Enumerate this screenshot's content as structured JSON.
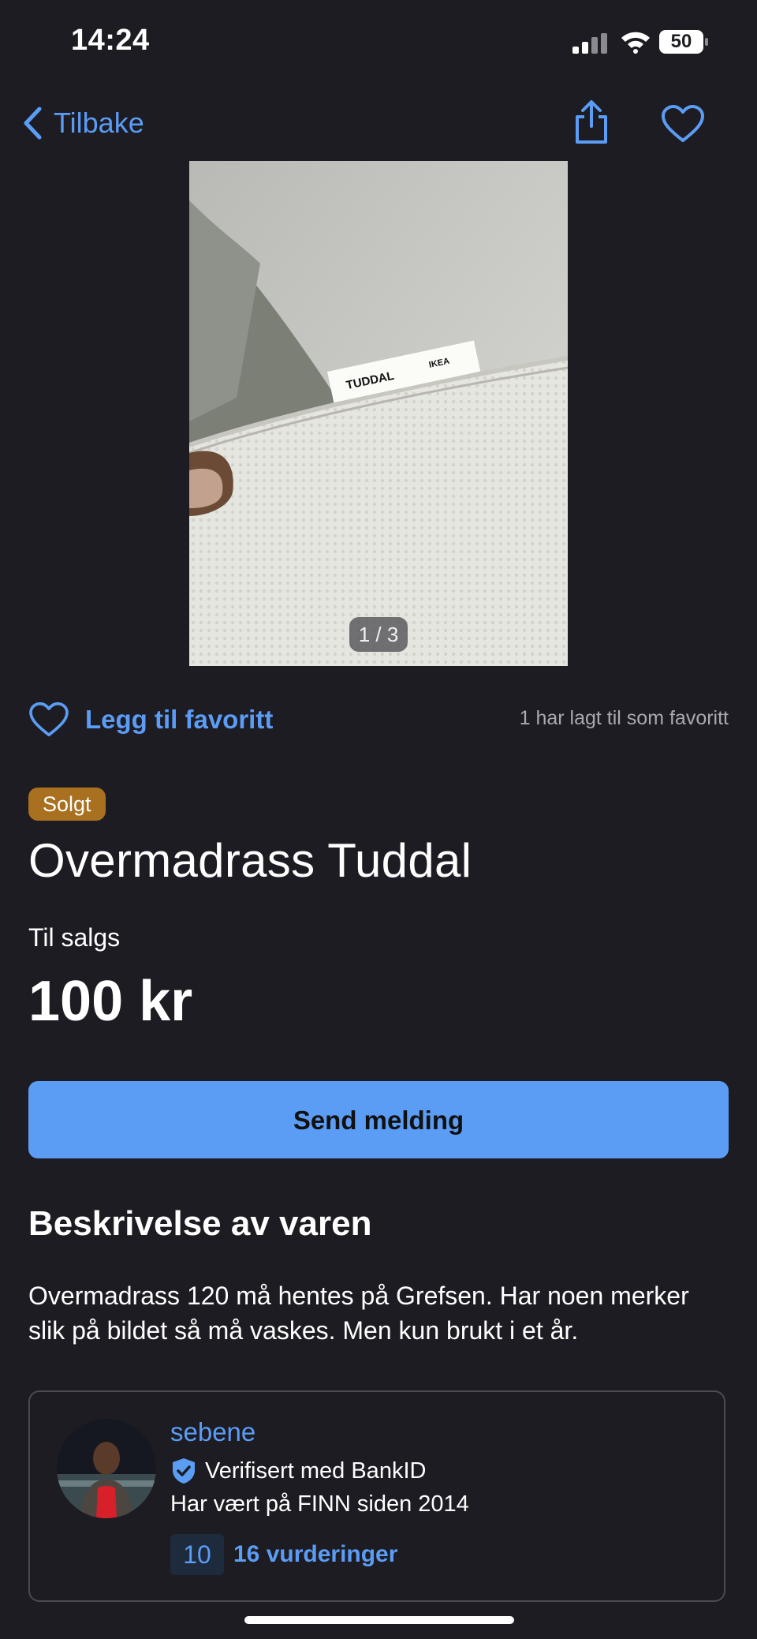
{
  "status_bar": {
    "time": "14:24",
    "battery": "50"
  },
  "nav": {
    "back_label": "Tilbake",
    "back_icon": "chevron-left-icon",
    "share_icon": "share-icon",
    "favorite_icon": "heart-icon"
  },
  "listing": {
    "image_counter": "1 / 3",
    "photo_tag_text": "TUDDAL",
    "photo_brand_text": "IKEA",
    "favorite_label": "Legg til favoritt",
    "favorite_count_text": "1 har lagt til som favoritt",
    "status_badge": "Solgt",
    "title": "Overmadrass Tuddal",
    "sale_type": "Til salgs",
    "price": "100 kr",
    "send_message_label": "Send melding",
    "description_heading": "Beskrivelse av varen",
    "description": "Overmadrass 120 må hentes på Grefsen. Har noen merker slik på bildet så må vaskes. Men kun brukt i et år."
  },
  "seller": {
    "name": "sebene",
    "verified_text": "Verifisert med BankID",
    "member_since": "Har vært på FINN siden 2014",
    "rating_score": "10",
    "rating_count": "16 vurderinger"
  },
  "colors": {
    "accent": "#5b9cf5",
    "background": "#1d1c22",
    "badge_sold": "#a8701f"
  }
}
